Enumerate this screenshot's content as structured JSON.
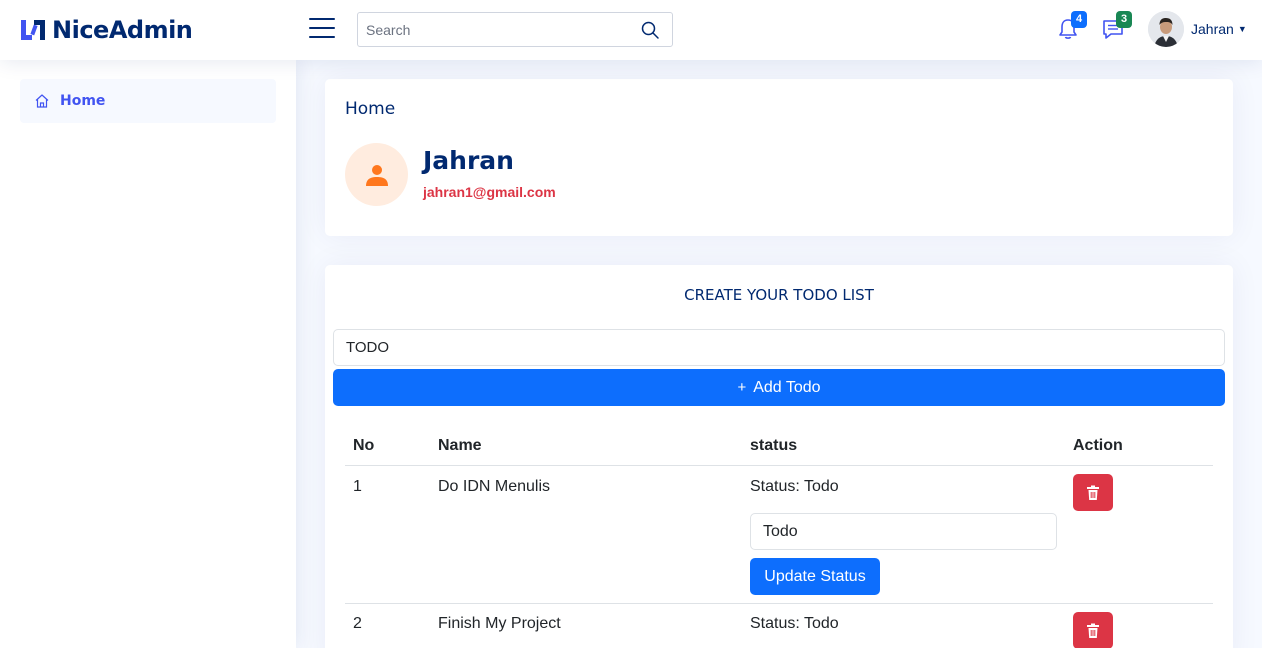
{
  "header": {
    "brand": "NiceAdmin",
    "search_placeholder": "Search",
    "notifications_count": "4",
    "messages_count": "3",
    "user_name": "Jahran"
  },
  "sidebar": {
    "items": [
      {
        "label": "Home",
        "icon": "house-icon",
        "active": true
      }
    ]
  },
  "profile_card": {
    "title": "Home",
    "name": "Jahran",
    "email": "jahran1@gmail.com"
  },
  "todo": {
    "title": "CREATE YOUR TODO LIST",
    "input_value": "TODO",
    "add_label": "Add Todo",
    "columns": [
      "No",
      "Name",
      "status",
      "Action"
    ],
    "rows": [
      {
        "no": "1",
        "name": "Do IDN Menulis",
        "status": "Status: Todo",
        "status_select": "Todo",
        "update_label": "Update Status"
      },
      {
        "no": "2",
        "name": "Finish My Project",
        "status": "Status: Todo"
      }
    ]
  },
  "colors": {
    "brand": "#012970",
    "accent": "#4154f1",
    "primary": "#0d6efd",
    "danger": "#dc3545",
    "badge_green": "#198754"
  }
}
